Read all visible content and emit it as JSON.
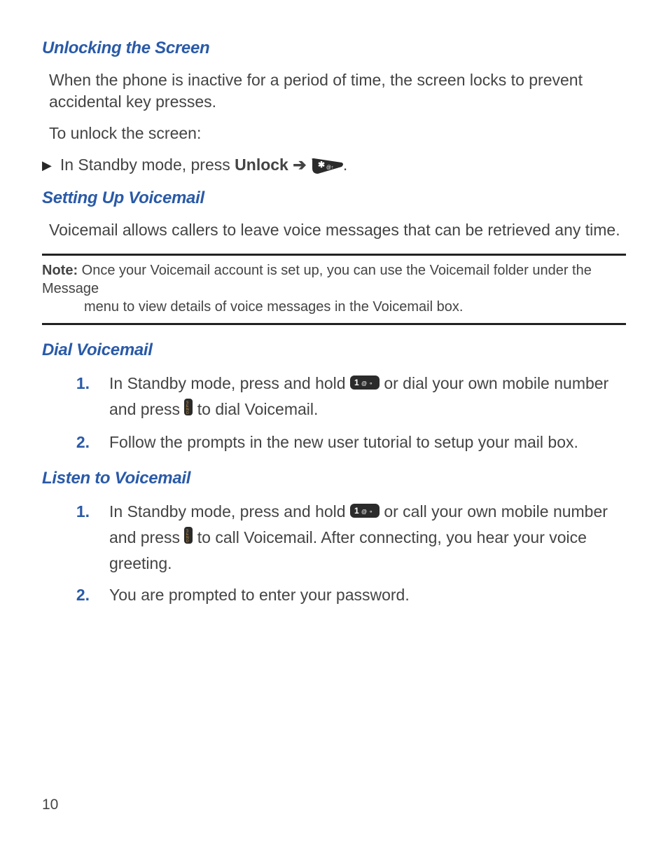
{
  "section1": {
    "heading": "Unlocking the Screen",
    "p1": "When the phone is inactive for a period of time, the screen locks to prevent accidental key presses.",
    "p2": "To unlock the screen:",
    "bullet_pre": "In Standby mode, press ",
    "bullet_bold": "Unlock",
    "bullet_arrow": " ➔ ",
    "bullet_post": "."
  },
  "section2": {
    "heading": "Setting Up Voicemail",
    "p1": "Voicemail allows callers to leave voice messages that can be retrieved any time."
  },
  "note": {
    "label": "Note:",
    "line1": " Once your Voicemail account is set up, you can use the Voicemail folder under the Message",
    "line2": "menu to view details of voice messages in the Voicemail box."
  },
  "section3": {
    "heading": "Dial Voicemail",
    "items": [
      {
        "num": "1.",
        "pre": "In Standby mode, press and hold ",
        "mid": " or dial your own mobile number and press ",
        "post": " to dial Voicemail."
      },
      {
        "num": "2.",
        "text": "Follow the prompts in the new user tutorial to setup your mail box."
      }
    ]
  },
  "section4": {
    "heading": "Listen to Voicemail",
    "items": [
      {
        "num": "1.",
        "pre": "In Standby mode, press and hold ",
        "mid": " or call your own mobile number and press ",
        "post": " to call Voicemail. After connecting, you hear your voice greeting."
      },
      {
        "num": "2.",
        "text": "You are prompted to enter your password."
      }
    ]
  },
  "page_number": "10"
}
